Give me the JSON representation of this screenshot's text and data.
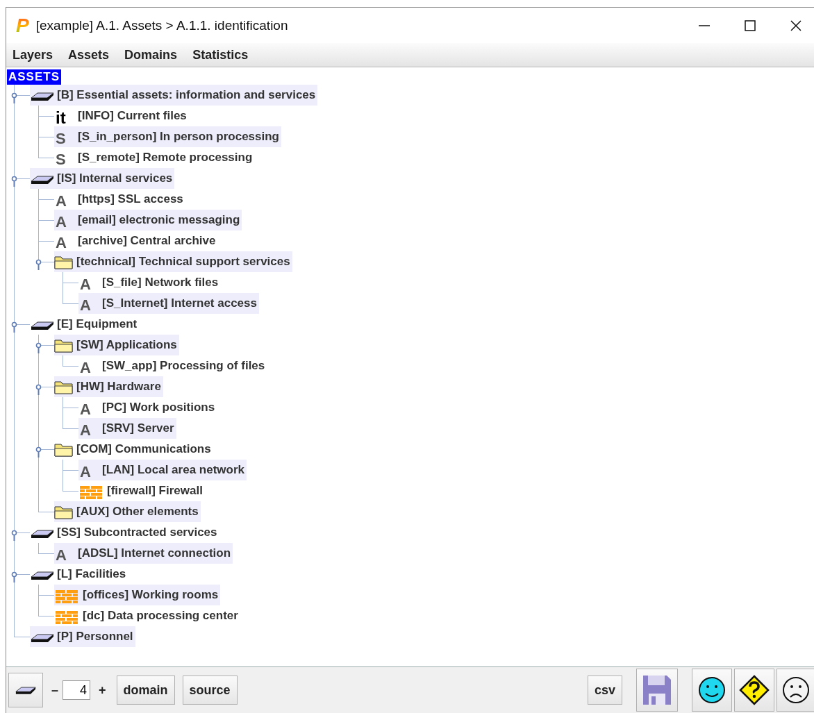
{
  "window": {
    "logo": "P",
    "title": "[example] A.1. Assets > A.1.1. identification"
  },
  "menu": [
    "Layers",
    "Assets",
    "Domains",
    "Statistics"
  ],
  "tree": {
    "root": "ASSETS",
    "nodes": [
      {
        "kind": "layer",
        "label": "[B] Essential assets: information and services",
        "expanded": true,
        "children": [
          {
            "kind": "info",
            "glyph": "it",
            "label": "[INFO] Current files"
          },
          {
            "kind": "service",
            "glyph": "S",
            "label": "[S_in_person] In person processing"
          },
          {
            "kind": "service",
            "glyph": "S",
            "label": "[S_remote] Remote processing"
          }
        ]
      },
      {
        "kind": "layer",
        "label": "[IS] Internal services",
        "expanded": true,
        "children": [
          {
            "kind": "asset",
            "glyph": "A",
            "label": "[https] SSL access"
          },
          {
            "kind": "asset",
            "glyph": "A",
            "label": "[email] electronic messaging"
          },
          {
            "kind": "asset",
            "glyph": "A",
            "label": "[archive] Central archive"
          },
          {
            "kind": "folder",
            "label": "[technical] Technical support services",
            "expanded": true,
            "children": [
              {
                "kind": "asset",
                "glyph": "A",
                "label": "[S_file] Network files"
              },
              {
                "kind": "asset",
                "glyph": "A",
                "label": "[S_Internet] Internet access"
              }
            ]
          }
        ]
      },
      {
        "kind": "layer",
        "label": "[E] Equipment",
        "expanded": true,
        "children": [
          {
            "kind": "folder",
            "label": "[SW] Applications",
            "expanded": true,
            "children": [
              {
                "kind": "asset",
                "glyph": "A",
                "label": "[SW_app] Processing of files"
              }
            ]
          },
          {
            "kind": "folder",
            "label": "[HW] Hardware",
            "expanded": true,
            "children": [
              {
                "kind": "asset",
                "glyph": "A",
                "label": "[PC] Work positions"
              },
              {
                "kind": "asset",
                "glyph": "A",
                "label": "[SRV] Server"
              }
            ]
          },
          {
            "kind": "folder",
            "label": "[COM] Communications",
            "expanded": true,
            "children": [
              {
                "kind": "asset",
                "glyph": "A",
                "label": "[LAN] Local area network"
              },
              {
                "kind": "wall",
                "label": "[firewall] Firewall"
              }
            ]
          },
          {
            "kind": "folder",
            "label": "[AUX] Other elements"
          }
        ]
      },
      {
        "kind": "layer",
        "label": "[SS] Subcontracted services",
        "expanded": true,
        "children": [
          {
            "kind": "asset",
            "glyph": "A",
            "label": "[ADSL] Internet connection"
          }
        ]
      },
      {
        "kind": "layer",
        "label": "[L] Facilities",
        "expanded": true,
        "children": [
          {
            "kind": "wall",
            "label": "[offices] Working rooms"
          },
          {
            "kind": "wall",
            "label": "[dc] Data processing center"
          }
        ]
      },
      {
        "kind": "layer",
        "label": "[P] Personnel"
      }
    ]
  },
  "toolbar": {
    "decrement": "–",
    "level_value": "4",
    "increment": "+",
    "buttons": [
      "domain",
      "source"
    ],
    "export": "csv"
  }
}
